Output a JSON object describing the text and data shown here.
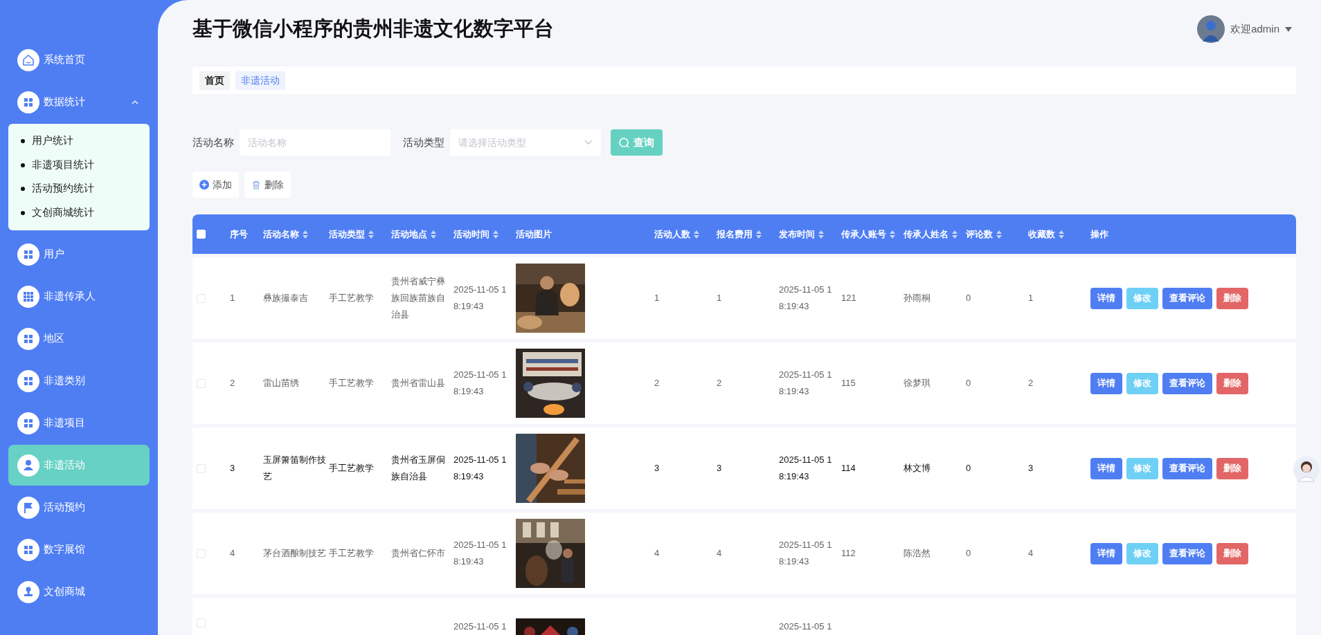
{
  "header": {
    "title": "基于微信小程序的贵州非遗文化数字平台",
    "user": "欢迎admin"
  },
  "sidebar": {
    "items": [
      {
        "label": "系统首页",
        "kind": "home",
        "selected": false
      },
      {
        "label": "数据统计",
        "kind": "grid",
        "selected": false,
        "expanded": true,
        "children": [
          {
            "label": "用户统计"
          },
          {
            "label": "非遗项目统计"
          },
          {
            "label": "活动预约统计"
          },
          {
            "label": "文创商城统计"
          }
        ]
      },
      {
        "label": "用户",
        "kind": "grid",
        "selected": false
      },
      {
        "label": "非遗传承人",
        "kind": "grid9",
        "selected": false
      },
      {
        "label": "地区",
        "kind": "grid",
        "selected": false
      },
      {
        "label": "非遗类别",
        "kind": "grid",
        "selected": false
      },
      {
        "label": "非遗项目",
        "kind": "grid",
        "selected": false
      },
      {
        "label": "非遗活动",
        "kind": "user",
        "selected": true
      },
      {
        "label": "活动预约",
        "kind": "flag",
        "selected": false
      },
      {
        "label": "数字展馆",
        "kind": "grid",
        "selected": false
      },
      {
        "label": "文创商城",
        "kind": "stamp",
        "selected": false
      }
    ]
  },
  "breadcrumb": [
    {
      "label": "首页",
      "selected": false
    },
    {
      "label": "非遗活动",
      "selected": true
    }
  ],
  "search": {
    "fields": [
      {
        "label": "活动名称",
        "kind": "text",
        "placeholder": "活动名称"
      },
      {
        "label": "活动类型",
        "kind": "select",
        "placeholder": "请选择活动类型"
      }
    ],
    "button": "查询"
  },
  "toolbar": [
    {
      "label": "添加",
      "kind": "add"
    },
    {
      "label": "删除",
      "kind": "delete"
    }
  ],
  "table": {
    "select_all": {
      "checked": false
    },
    "columns": [
      {
        "label": "序号",
        "sortable": false
      },
      {
        "label": "活动名称",
        "sortable": true
      },
      {
        "label": "活动类型",
        "sortable": true
      },
      {
        "label": "活动地点",
        "sortable": true
      },
      {
        "label": "活动时间",
        "sortable": true
      },
      {
        "label": "活动图片",
        "sortable": false
      },
      {
        "label": "活动人数",
        "sortable": true
      },
      {
        "label": "报名费用",
        "sortable": true
      },
      {
        "label": "发布时间",
        "sortable": true
      },
      {
        "label": "传承人账号",
        "sortable": true
      },
      {
        "label": "传承人姓名",
        "sortable": true
      },
      {
        "label": "评论数",
        "sortable": true
      },
      {
        "label": "收藏数",
        "sortable": true
      },
      {
        "label": "操作",
        "sortable": false
      }
    ],
    "rows": [
      {
        "checked": false,
        "hovered": false,
        "cells": [
          "1",
          "彝族撮泰吉",
          "手工艺教学",
          "贵州省威宁彝族回族苗族自治县",
          "2025-11-05 18:19:43",
          {
            "kind": "picture"
          },
          "1",
          "1",
          "2025-11-05 18:19:43",
          "121",
          "孙雨桐",
          "0",
          "1"
        ],
        "actions": [
          {
            "label": "详情",
            "kind": "detail"
          },
          {
            "label": "修改",
            "kind": "edit"
          },
          {
            "label": "查看评论",
            "kind": "detail"
          },
          {
            "label": "删除",
            "kind": "delete"
          }
        ]
      },
      {
        "checked": false,
        "hovered": false,
        "cells": [
          "2",
          "雷山苗绣",
          "手工艺教学",
          "贵州省雷山县",
          "2025-11-05 18:19:43",
          {
            "kind": "picture"
          },
          "2",
          "2",
          "2025-11-05 18:19:43",
          "115",
          "徐梦琪",
          "0",
          "2"
        ],
        "actions": [
          {
            "label": "详情",
            "kind": "detail"
          },
          {
            "label": "修改",
            "kind": "edit"
          },
          {
            "label": "查看评论",
            "kind": "detail"
          },
          {
            "label": "删除",
            "kind": "delete"
          }
        ]
      },
      {
        "checked": false,
        "hovered": true,
        "cells": [
          "3",
          "玉屏箫笛制作技艺",
          "手工艺教学",
          "贵州省玉屏侗族自治县",
          "2025-11-05 18:19:43",
          {
            "kind": "picture"
          },
          "3",
          "3",
          "2025-11-05 18:19:43",
          "114",
          "林文博",
          "0",
          "3"
        ],
        "actions": [
          {
            "label": "详情",
            "kind": "detail"
          },
          {
            "label": "修改",
            "kind": "edit"
          },
          {
            "label": "查看评论",
            "kind": "detail"
          },
          {
            "label": "删除",
            "kind": "delete"
          }
        ]
      },
      {
        "checked": false,
        "hovered": false,
        "cells": [
          "4",
          "茅台酒酿制技艺",
          "手工艺教学",
          "贵州省仁怀市",
          "2025-11-05 18:19:43",
          {
            "kind": "picture"
          },
          "4",
          "4",
          "2025-11-05 18:19:43",
          "112",
          "陈浩然",
          "0",
          "4"
        ],
        "actions": [
          {
            "label": "详情",
            "kind": "detail"
          },
          {
            "label": "修改",
            "kind": "edit"
          },
          {
            "label": "查看评论",
            "kind": "detail"
          },
          {
            "label": "删除",
            "kind": "delete"
          }
        ]
      },
      {
        "checked": false,
        "hovered": false,
        "cells": [
          null,
          null,
          null,
          null,
          "2025-11-05 1",
          {
            "kind": "picture"
          },
          null,
          null,
          "2025-11-05 1",
          null,
          null,
          null,
          null
        ],
        "actions": []
      }
    ]
  }
}
